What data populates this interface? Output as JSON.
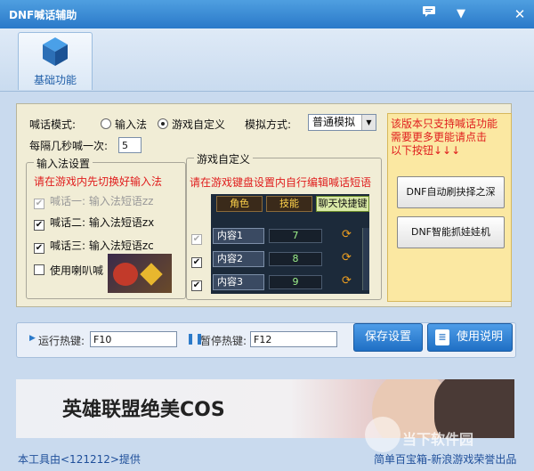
{
  "window": {
    "title": "DNF喊话辅助"
  },
  "toolbar": {
    "basic_label": "基础功能"
  },
  "main": {
    "mode_label": "喊话模式:",
    "mode_options": [
      "输入法",
      "游戏自定义"
    ],
    "method_label": "模拟方式:",
    "method_value": "普通模拟",
    "interval_label": "每隔几秒喊一次:",
    "interval_value": "5",
    "ime_group": {
      "title": "输入法设置",
      "hint": "请在游戏内先切换好输入法",
      "items": [
        {
          "label": "喊话一: 输入法短语zz",
          "checked": true,
          "disabled": true
        },
        {
          "label": "喊话二: 输入法短语zx",
          "checked": true,
          "disabled": false
        },
        {
          "label": "喊话三: 输入法短语zc",
          "checked": true,
          "disabled": false
        },
        {
          "label": "使用喇叭喊",
          "checked": false,
          "disabled": false
        }
      ]
    },
    "game_group": {
      "title": "游戏自定义",
      "hint": "请在游戏键盘设置内自行编辑喊话短语",
      "tabs": [
        "角色",
        "技能",
        "聊天快捷键"
      ],
      "rows": [
        {
          "label": "内容1",
          "value": "7",
          "checked": true,
          "disabled": true
        },
        {
          "label": "内容2",
          "value": "8",
          "checked": true,
          "disabled": false
        },
        {
          "label": "内容3",
          "value": "9",
          "checked": true,
          "disabled": false
        }
      ]
    }
  },
  "side": {
    "notice": "该版本只支持喊话功能\n需要更多更能请点击\n以下按钮↓↓↓",
    "btn1": "DNF自动刷抉择之深",
    "btn2": "DNF智能抓娃娃机"
  },
  "hotkeys": {
    "run_label": "运行热键:",
    "run_value": "F10",
    "pause_label": "暂停热键:",
    "pause_value": "F12",
    "save_label": "保存设置",
    "help_label": "使用说明"
  },
  "banner": {
    "text": "英雄联盟绝美COS"
  },
  "status": {
    "left": "本工具由<121212>提供",
    "right": "简单百宝箱-新浪游戏荣誉出品",
    "watermark": "当下软件园"
  },
  "colors": {
    "accent": "#2a79c9",
    "notice_red": "#e01e1e"
  }
}
